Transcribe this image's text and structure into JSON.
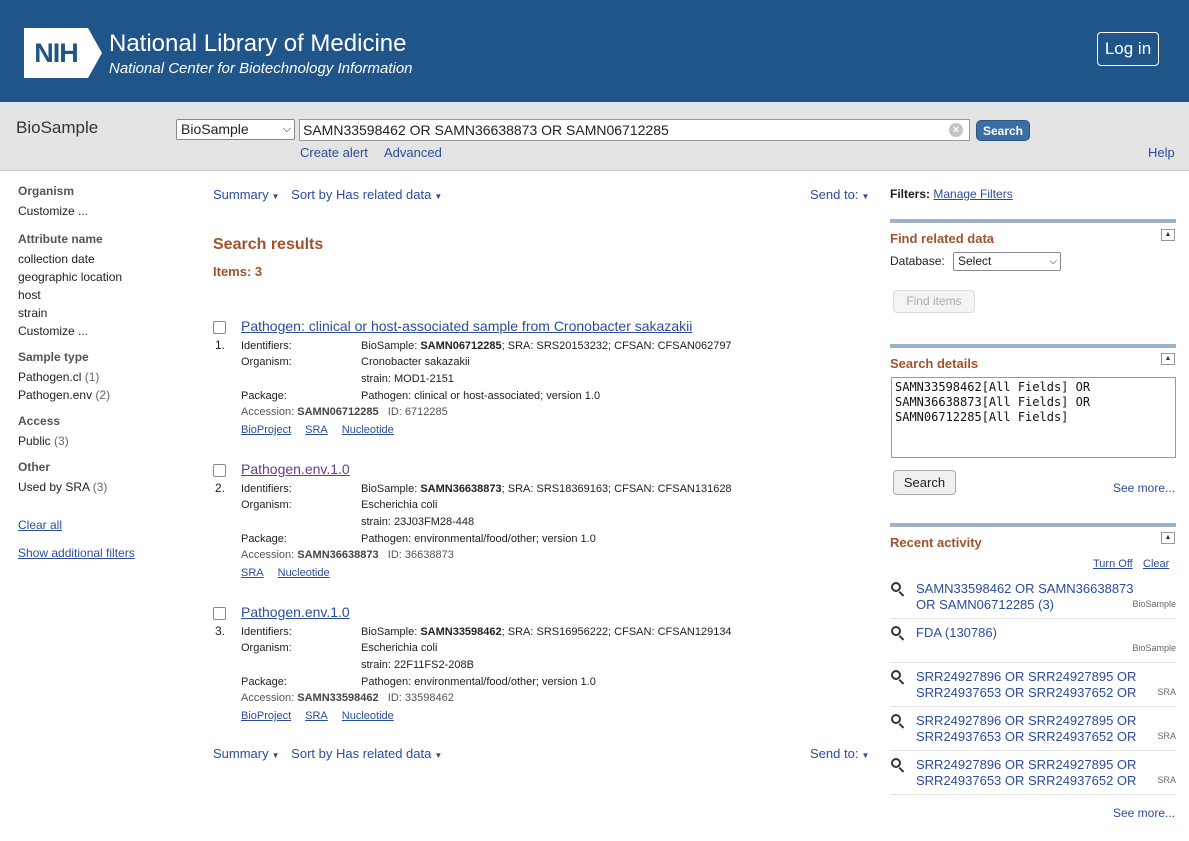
{
  "header": {
    "logo_text": "NIH",
    "title": "National Library of Medicine",
    "subtitle": "National Center for Biotechnology Information",
    "login": "Log in"
  },
  "searchbar": {
    "db_name": "BioSample",
    "db_select": "BioSample",
    "term": "SAMN33598462 OR SAMN36638873 OR SAMN06712285",
    "search_btn": "Search",
    "create_alert": "Create alert",
    "advanced": "Advanced",
    "help": "Help"
  },
  "sidebar": {
    "groups": [
      {
        "head": "Organism",
        "items": [
          {
            "label": "Customize ...",
            "count": ""
          }
        ]
      },
      {
        "head": "Attribute name",
        "items": [
          {
            "label": "collection date",
            "count": ""
          },
          {
            "label": "geographic location",
            "count": ""
          },
          {
            "label": "host",
            "count": ""
          },
          {
            "label": "strain",
            "count": ""
          },
          {
            "label": "Customize ...",
            "count": ""
          }
        ]
      },
      {
        "head": "Sample type",
        "items": [
          {
            "label": "Pathogen.cl",
            "count": "(1)"
          },
          {
            "label": "Pathogen.env",
            "count": "(2)"
          }
        ]
      },
      {
        "head": "Access",
        "items": [
          {
            "label": "Public",
            "count": "(3)"
          }
        ]
      },
      {
        "head": "Other",
        "items": [
          {
            "label": "Used by SRA",
            "count": "(3)"
          }
        ]
      }
    ],
    "clear_all": "Clear all",
    "show_additional": "Show additional filters"
  },
  "toolbar": {
    "summary": "Summary",
    "sort": "Sort by Has related data",
    "send_to": "Send to:"
  },
  "results": {
    "title": "Search results",
    "items": "Items: 3",
    "labels": {
      "identifiers": "Identifiers:",
      "organism": "Organism:",
      "package": "Package:",
      "accession": "Accession:",
      "id": "ID:"
    },
    "list": [
      {
        "num": "1.",
        "title": "Pathogen: clinical or host-associated sample from Cronobacter sakazakii",
        "id_pre": "BioSample: ",
        "id_bold": "SAMN06712285",
        "id_post": "; SRA: SRS20153232; CFSAN: CFSAN062797",
        "organism": "Cronobacter sakazakii",
        "strain": "strain: MOD1-2151",
        "package": "Pathogen: clinical or host-associated; version 1.0",
        "accession": "SAMN06712285",
        "uid": "6712285",
        "links": [
          "BioProject",
          "SRA",
          "Nucleotide"
        ]
      },
      {
        "num": "2.",
        "title": "Pathogen.env.1.0",
        "id_pre": "BioSample: ",
        "id_bold": "SAMN36638873",
        "id_post": "; SRA: SRS18369163; CFSAN: CFSAN131628",
        "organism": "Escherichia coli",
        "strain": "strain: 23J03FM28-448",
        "package": "Pathogen: environmental/food/other; version 1.0",
        "accession": "SAMN36638873",
        "uid": "36638873",
        "links": [
          "SRA",
          "Nucleotide"
        ]
      },
      {
        "num": "3.",
        "title": "Pathogen.env.1.0",
        "id_pre": "BioSample: ",
        "id_bold": "SAMN33598462",
        "id_post": "; SRA: SRS16956222; CFSAN: CFSAN129134",
        "organism": "Escherichia coli",
        "strain": "strain: 22F11FS2-208B",
        "package": "Pathogen: environmental/food/other; version 1.0",
        "accession": "SAMN33598462",
        "uid": "33598462",
        "links": [
          "BioProject",
          "SRA",
          "Nucleotide"
        ]
      }
    ]
  },
  "right": {
    "filters_label": "Filters:",
    "manage_filters": "Manage Filters",
    "find_related": {
      "title": "Find related data",
      "db_label": "Database:",
      "db_value": "Select",
      "find_btn": "Find items"
    },
    "search_details": {
      "title": "Search details",
      "query": "SAMN33598462[All Fields] OR\nSAMN36638873[All Fields] OR\nSAMN06712285[All Fields]",
      "search_btn": "Search",
      "see_more": "See more..."
    },
    "recent": {
      "title": "Recent activity",
      "turn_off": "Turn Off",
      "clear": "Clear",
      "items": [
        {
          "text": "SAMN33598462 OR SAMN36638873 OR SAMN06712285 (3)",
          "db": "BioSample"
        },
        {
          "text": "FDA (130786)",
          "db": "BioSample"
        },
        {
          "text": "SRR24927896 OR SRR24927895 OR SRR24937653 OR SRR24937652 OR",
          "db": "SRA"
        },
        {
          "text": "SRR24927896 OR SRR24927895 OR SRR24937653 OR SRR24937652 OR",
          "db": "SRA"
        },
        {
          "text": "SRR24927896 OR SRR24927895 OR SRR24937653 OR SRR24937652 OR",
          "db": "SRA"
        }
      ],
      "see_more": "See more..."
    }
  }
}
